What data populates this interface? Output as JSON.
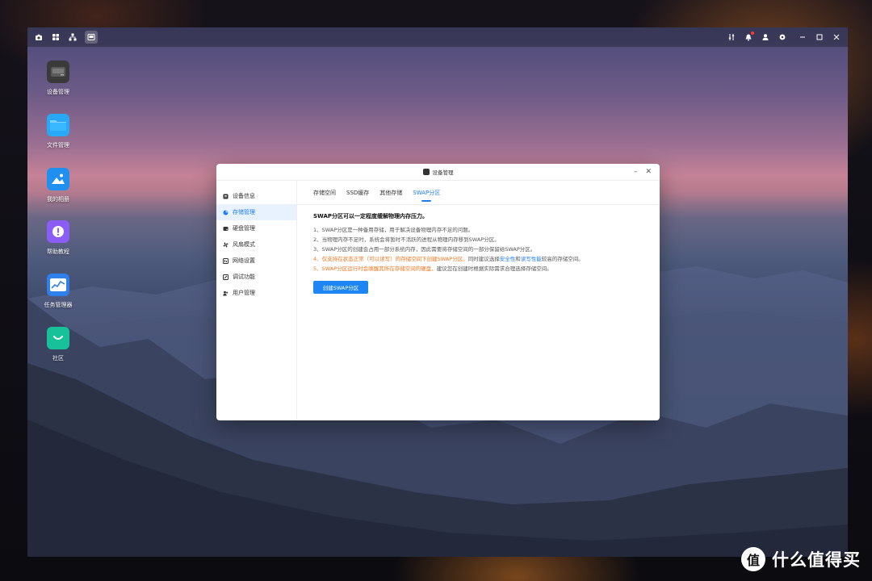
{
  "topbar": {
    "left_icons": [
      "camera-icon",
      "apps-grid-icon",
      "network-tree-icon",
      "device-manager-icon"
    ],
    "right_icons": [
      "settings-sliders-icon",
      "notification-bell-icon",
      "user-icon",
      "gear-icon"
    ],
    "window_controls": [
      "minimize",
      "maximize",
      "close"
    ]
  },
  "desktop": {
    "icons": [
      {
        "label": "设备管理",
        "icon": "device-manager-icon",
        "color": "#3a3a3a"
      },
      {
        "label": "文件管理",
        "icon": "folder-icon",
        "color": "#29a9f5"
      },
      {
        "label": "我的相册",
        "icon": "photo-album-icon",
        "color": "#1f8ff0"
      },
      {
        "label": "帮助教程",
        "icon": "help-icon",
        "color": "#8b5cf6"
      },
      {
        "label": "任务管理器",
        "icon": "task-monitor-icon",
        "color": "#2f7fec"
      },
      {
        "label": "社区",
        "icon": "community-icon",
        "color": "#19c19b"
      }
    ]
  },
  "window": {
    "title": "设备管理",
    "sidebar": {
      "items": [
        {
          "label": "设备信息",
          "icon": "info-icon",
          "active": false
        },
        {
          "label": "存储管理",
          "icon": "storage-pie-icon",
          "active": true
        },
        {
          "label": "硬盘管理",
          "icon": "disk-icon",
          "active": false
        },
        {
          "label": "风扇模式",
          "icon": "fan-icon",
          "active": false
        },
        {
          "label": "网络设置",
          "icon": "network-icon",
          "active": false
        },
        {
          "label": "调试功能",
          "icon": "debug-icon",
          "active": false
        },
        {
          "label": "用户管理",
          "icon": "users-icon",
          "active": false
        }
      ]
    },
    "tabs": [
      {
        "label": "存储空间",
        "active": false
      },
      {
        "label": "SSD缓存",
        "active": false
      },
      {
        "label": "其他存储",
        "active": false
      },
      {
        "label": "SWAP分区",
        "active": true
      }
    ],
    "content": {
      "heading": "SWAP分区可以一定程度缓解物理内存压力。",
      "line1": "1、SWAP分区是一种备用存储，用于解决设备物理内存不足的问题。",
      "line2": "2、当物理内存不足时，系统会将暂时不活跃的进程从物理内存移到SWAP分区。",
      "line3": "3、SWAP分区的创建会占用一部分系统内存，因此需要将存储空间的一部分保留给SWAP分区。",
      "line4_prefix": "4、",
      "line4_warn": "仅支持在状态正常（可以读写）的存储空间下创建SWAP分区。",
      "line4_mid": "同时建议选择",
      "line4_blue1": "安全性",
      "line4_and": "和",
      "line4_blue2": "读写性能",
      "line4_tail": "较高的存储空间。",
      "line5_prefix": "5、",
      "line5_warn": "SWAP分区运行时会唤醒其所在存储空间的硬盘，",
      "line5_tail": "建议您在创建时根据实际需求合理选择存储空间。",
      "button": "创建SWAP分区"
    }
  },
  "watermark": {
    "badge": "值",
    "text": "什么值得买"
  },
  "colors": {
    "accent": "#1d7cf2",
    "warning": "#f0761f",
    "active_bg": "#e8f2ff"
  }
}
